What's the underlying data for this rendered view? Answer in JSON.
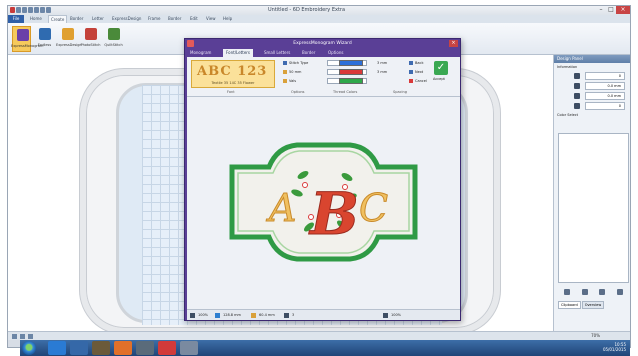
{
  "app": {
    "title": "Untitled - 6D Embroidery Extra"
  },
  "ribbon_tabs": [
    "File",
    "Home",
    "Create",
    "Border",
    "Letter",
    "ExpressDesign",
    "Frame",
    "Border",
    "Edit",
    "View",
    "Help"
  ],
  "ribbon_buttons": [
    {
      "label": "ExpressMonogram",
      "color": "#6a3fa8"
    },
    {
      "label": "Endless",
      "color": "#2f6bb0"
    },
    {
      "label": "ExpressDesign",
      "color": "#e0a030"
    },
    {
      "label": "PhotoStitch",
      "color": "#c4423a"
    },
    {
      "label": "QuiltStitch",
      "color": "#4a8a3a"
    }
  ],
  "dialog": {
    "title": "ExpressMonogram Wizard",
    "tabs": [
      "Monogram",
      "Font/Letters",
      "Small Letters",
      "Border",
      "Options"
    ],
    "active_tab": "Font/Letters",
    "font_preview_letters": "ABC 123",
    "font_name": "Textile 35 14C 35 Flower",
    "groups": [
      "Font",
      "Options",
      "Thread Colors",
      "Spacing"
    ],
    "options": {
      "stitch_type_label": "Stitch Type",
      "size_value": "50 mm",
      "height_value": "Vals"
    },
    "thread_colors": [
      "#2c6fd8",
      "#d9393a",
      "#2ea84a"
    ],
    "spacing": {
      "value1": "3 mm",
      "value2": "3 mm",
      "checks": [
        "Back",
        "Next",
        "Cancel"
      ]
    },
    "accept_label": "Accept",
    "monogram_text": [
      "A",
      "B",
      "C"
    ],
    "status": {
      "zoom": "100%",
      "width": "128.8 mm",
      "height": "60.4 mm",
      "count": "3",
      "zoom_percent": "100%"
    }
  },
  "design_panel": {
    "title": "Design Panel",
    "information_label": "Information",
    "rows": [
      {
        "icon": "stitches-icon",
        "value": "0"
      },
      {
        "icon": "width-icon",
        "value": "0.0 mm"
      },
      {
        "icon": "height-icon",
        "value": "0.0 mm"
      },
      {
        "icon": "colors-icon",
        "value": "0"
      }
    ],
    "color_select_label": "Color Select",
    "bottom_tabs": [
      "Clipboard",
      "Overview"
    ]
  },
  "app_status": {
    "zoom": "70%"
  },
  "tray": {
    "time": "10:55",
    "date": "05/01/2015"
  }
}
